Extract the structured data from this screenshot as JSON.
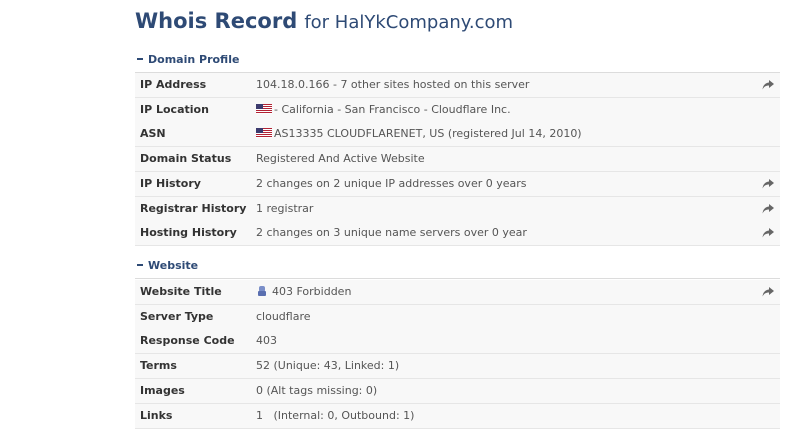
{
  "header": {
    "title": "Whois Record",
    "subtitle": "for HalYkCompany.com"
  },
  "sections": [
    {
      "heading": "Domain Profile",
      "rows": [
        {
          "label": "IP Address",
          "value": "104.18.0.166 - 7 other sites hosted on this server",
          "has_share": true
        },
        {
          "label": "IP Location",
          "value": "- California - San Francisco - Cloudflare Inc.",
          "flag": "us-flag-icon"
        },
        {
          "label": "ASN",
          "value": "AS13335 CLOUDFLARENET, US (registered Jul 14, 2010)",
          "flag": "us-flag-icon"
        },
        {
          "label": "Domain Status",
          "value": "Registered And Active Website"
        },
        {
          "label": "IP History",
          "value": "2 changes on 2 unique IP addresses over 0 years",
          "has_share": true
        },
        {
          "label": "Registrar History",
          "value": "1 registrar",
          "has_share": true
        },
        {
          "label": "Hosting History",
          "value": "2 changes on 3 unique name servers over 0 year",
          "has_share": true
        }
      ]
    },
    {
      "heading": "Website",
      "rows": [
        {
          "label": "Website Title",
          "value": "403 Forbidden",
          "site_icon": "site-favicon-icon",
          "has_share": true
        },
        {
          "label": "Server Type",
          "value": "cloudflare"
        },
        {
          "label": "Response Code",
          "value": "403"
        },
        {
          "label": "Terms",
          "value": "52 (Unique: 43, Linked: 1)"
        },
        {
          "label": "Images",
          "value": "0 (Alt tags missing: 0)"
        },
        {
          "label": "Links",
          "value": "1   (Internal: 0, Outbound: 1)"
        }
      ]
    }
  ],
  "colors": {
    "heading": "#2e4a75",
    "row_bg": "#f8f8f8",
    "share_icon": "#666666"
  }
}
